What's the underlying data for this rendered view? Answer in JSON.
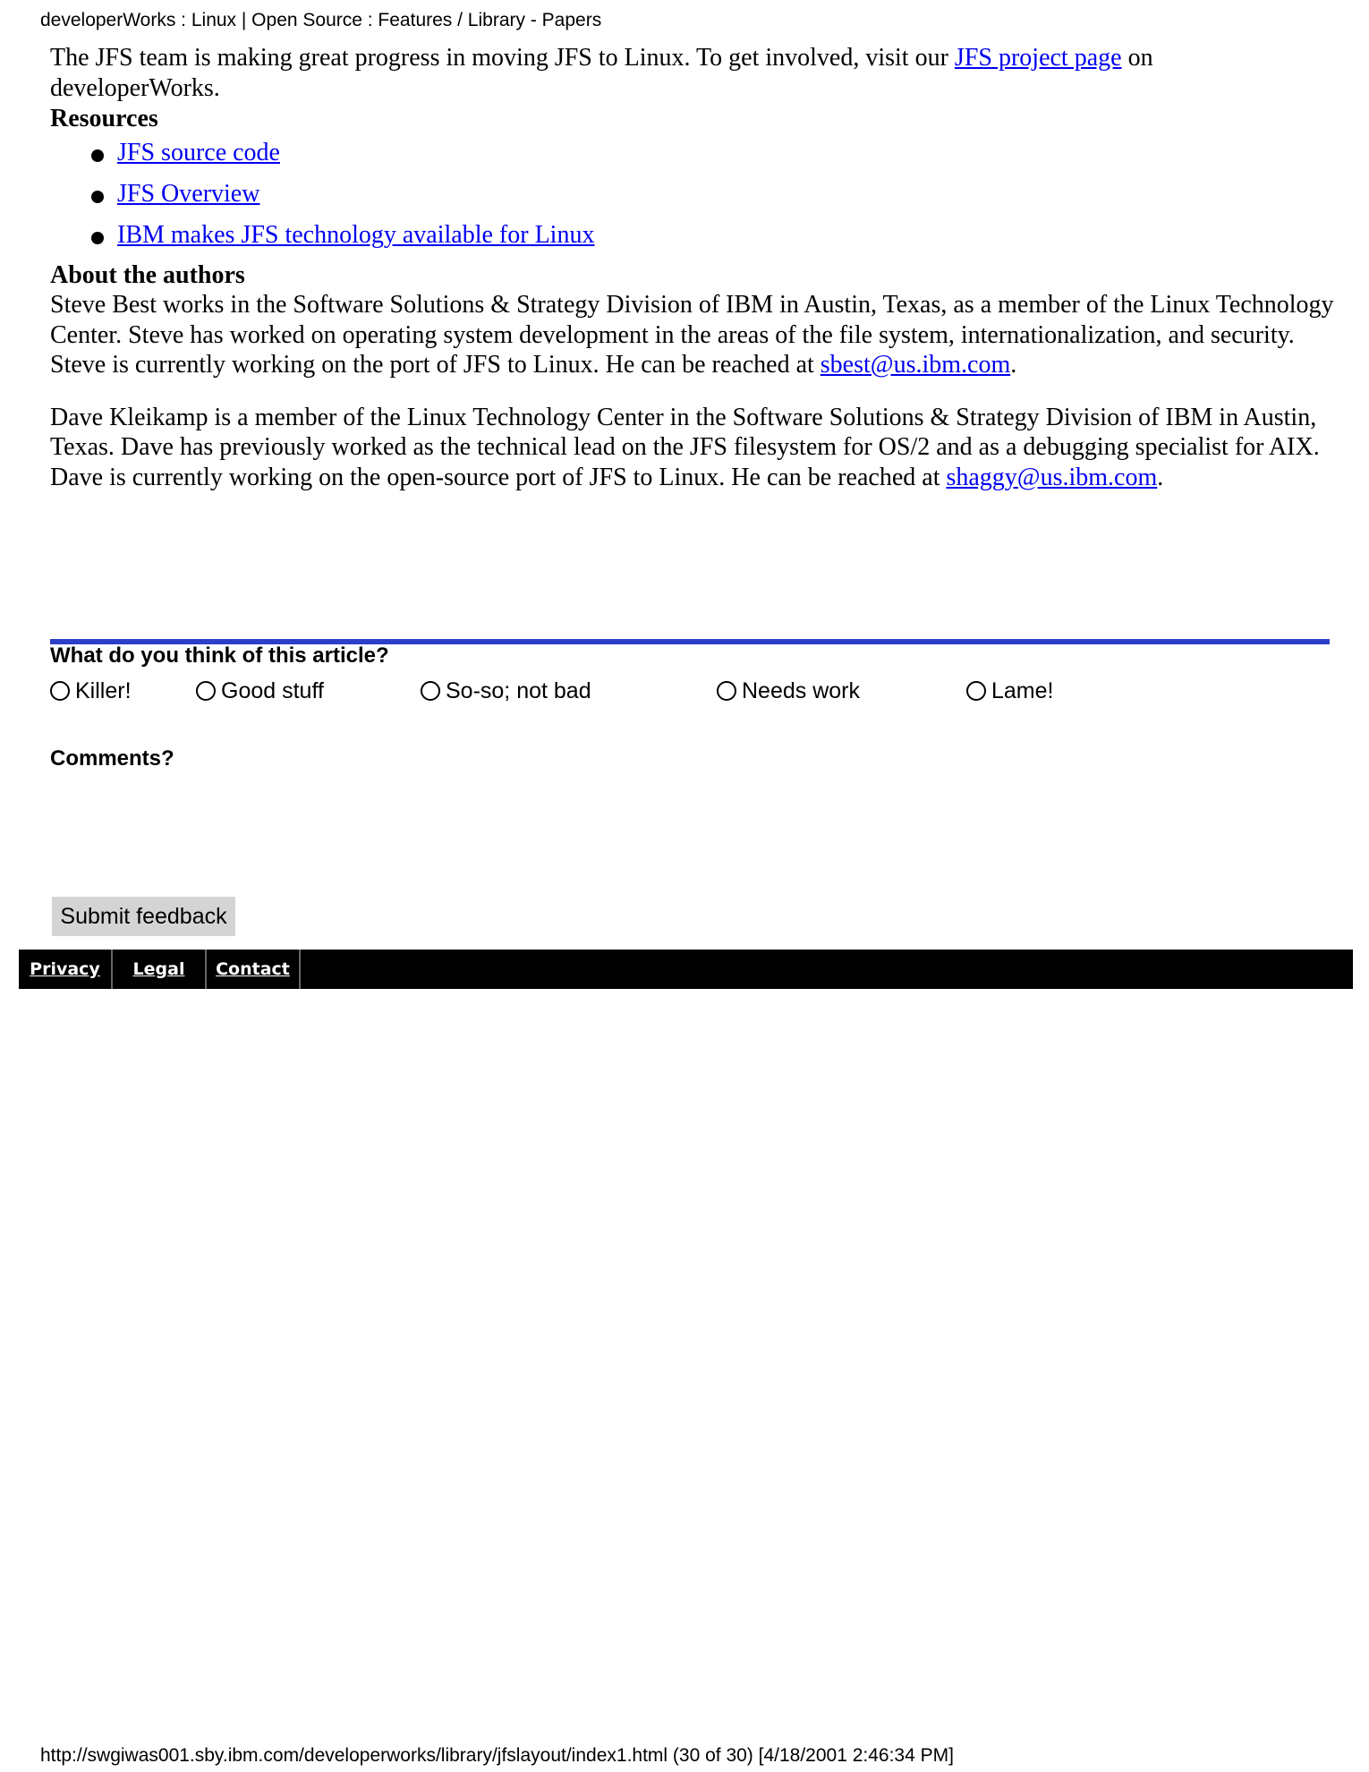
{
  "header": {
    "text": "developerWorks : Linux | Open Source : Features / Library - Papers"
  },
  "intro": {
    "text_before": "The JFS team is making great progress in moving JFS to Linux. To get involved, visit our ",
    "link": "JFS project page",
    "text_after": " on developerWorks."
  },
  "resources": {
    "heading": "Resources",
    "items": [
      "JFS source code",
      "JFS Overview",
      "IBM makes JFS technology available for Linux"
    ]
  },
  "authors": {
    "heading": "About the authors",
    "bios": [
      {
        "text": "Steve Best works in the Software Solutions & Strategy Division of IBM in Austin, Texas, as a member of the Linux Technology Center. Steve has worked on operating system development in the areas of the file system, internationalization, and security. Steve is currently working on the port of JFS to Linux. He can be reached at ",
        "email": "sbest@us.ibm.com",
        "end": "."
      },
      {
        "text": "Dave Kleikamp is a member of the Linux Technology Center in the Software Solutions & Strategy Division of IBM in Austin, Texas. Dave has previously worked as the technical lead on the JFS filesystem for OS/2 and as a debugging specialist for AIX. Dave is currently working on the open-source port of JFS to Linux. He can be reached at ",
        "email": "shaggy@us.ibm.com",
        "end": "."
      }
    ]
  },
  "feedback": {
    "question": "What do you think of this article?",
    "options": [
      "Killer!",
      "Good stuff",
      "So-so; not bad",
      "Needs work",
      "Lame!"
    ],
    "comments_label": "Comments?",
    "submit_label": "Submit feedback",
    "rule_color": "#2b3fc9"
  },
  "footer_links": [
    "Privacy",
    "Legal",
    "Contact"
  ],
  "print_footer": {
    "text": "http://swgiwas001.sby.ibm.com/developerworks/library/jfslayout/index1.html (30 of 30) [4/18/2001 2:46:34 PM]"
  }
}
